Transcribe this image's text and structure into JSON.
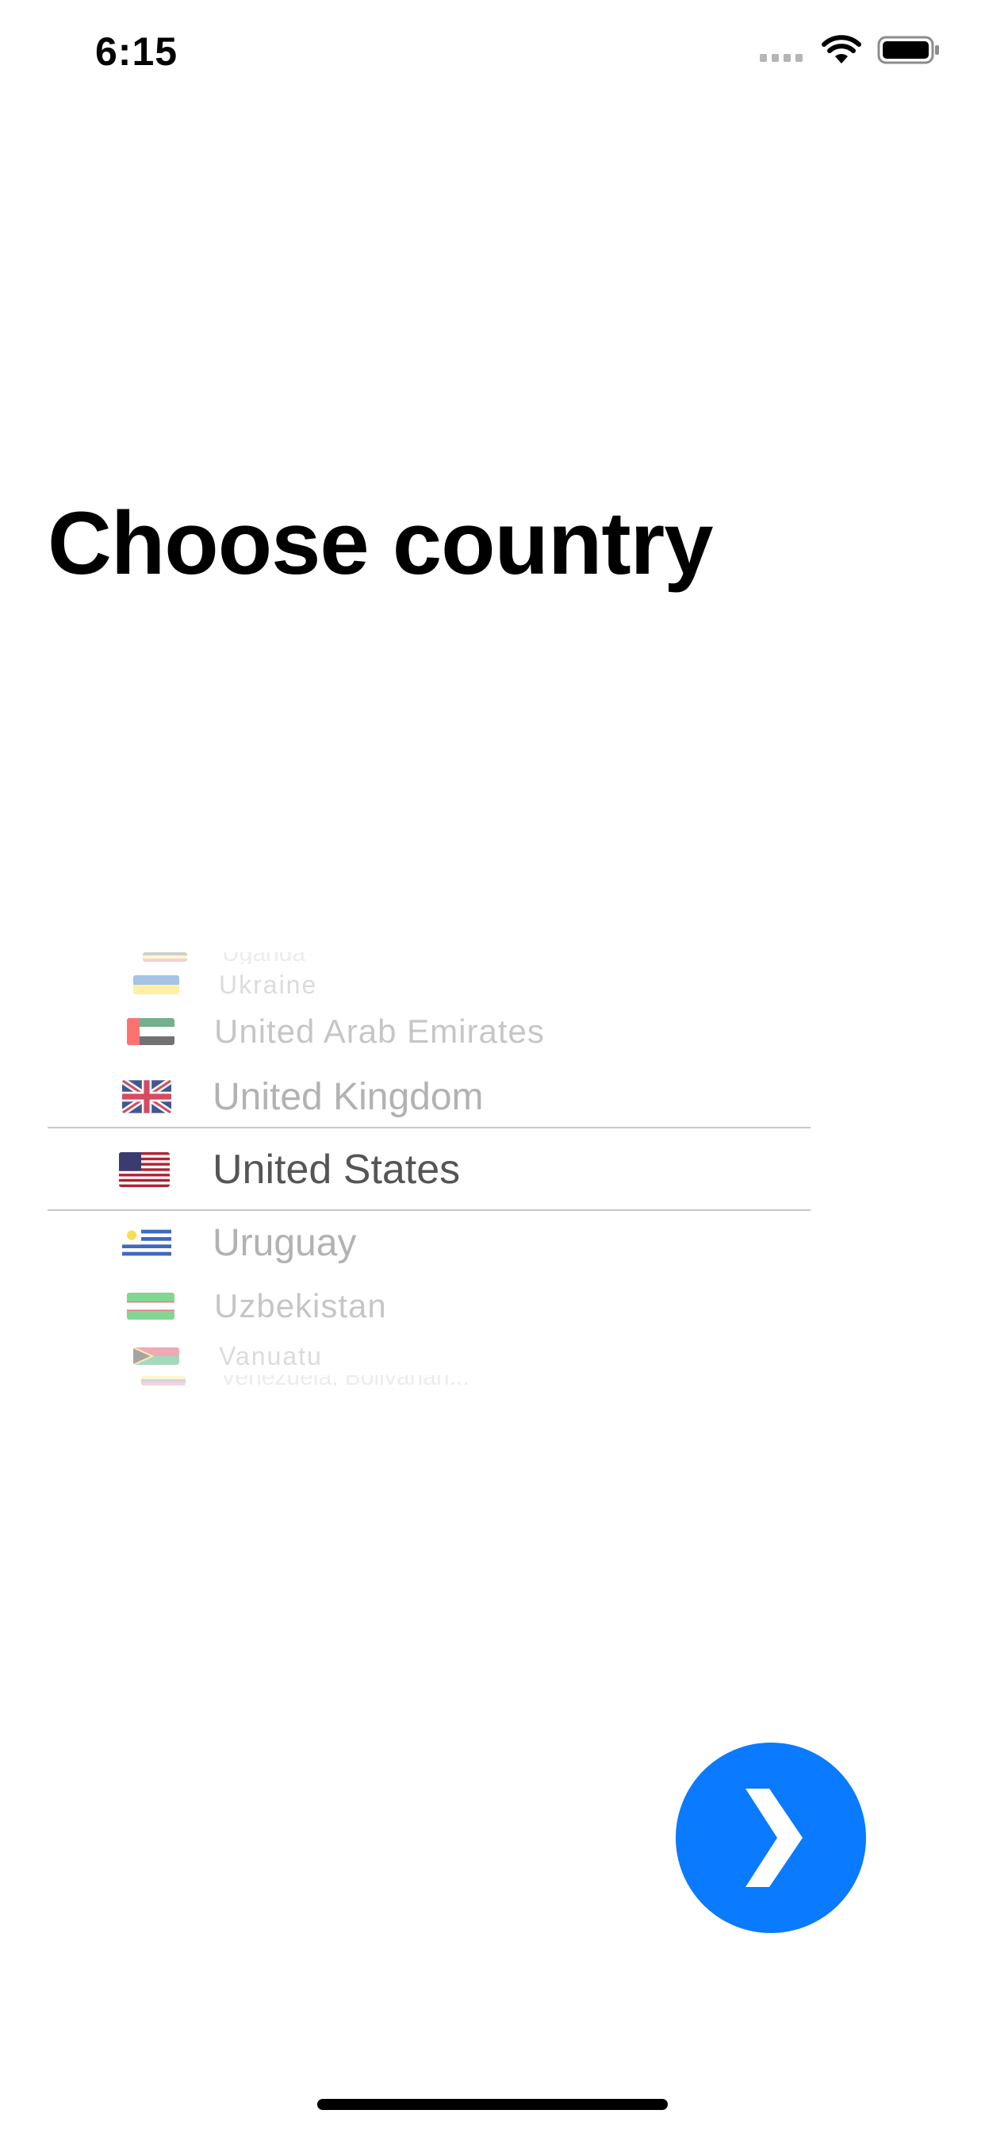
{
  "status_bar": {
    "time": "6:15"
  },
  "title": "Choose country",
  "picker": {
    "selected": "United States",
    "items": [
      {
        "label": "Uganda",
        "flag": "uganda-flag-icon"
      },
      {
        "label": "Ukraine",
        "flag": "ukraine-flag-icon"
      },
      {
        "label": "United Arab Emirates",
        "flag": "uae-flag-icon"
      },
      {
        "label": "United Kingdom",
        "flag": "uk-flag-icon"
      },
      {
        "label": "United States",
        "flag": "us-flag-icon"
      },
      {
        "label": "Uruguay",
        "flag": "uruguay-flag-icon"
      },
      {
        "label": "Uzbekistan",
        "flag": "uzbekistan-flag-icon"
      },
      {
        "label": "Vanuatu",
        "flag": "vanuatu-flag-icon"
      },
      {
        "label": "Venezuela, Bolivarian...",
        "flag": "venezuela-flag-icon"
      }
    ]
  },
  "next_button": {
    "icon": "chevron-right-icon"
  },
  "colors": {
    "accent": "#0a7aff",
    "selected_text": "#555555",
    "faded_text": "#b8b8b8",
    "divider": "#c7c7cc"
  }
}
